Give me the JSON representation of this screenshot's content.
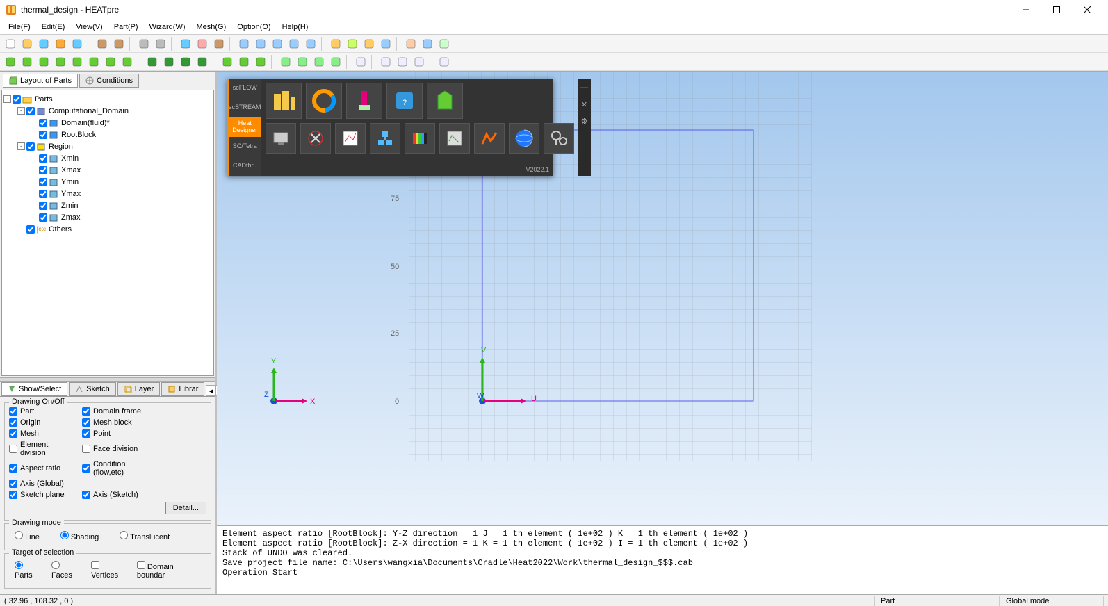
{
  "title": "thermal_design - HEATpre",
  "menu": [
    "File(F)",
    "Edit(E)",
    "View(V)",
    "Part(P)",
    "Wizard(W)",
    "Mesh(G)",
    "Option(O)",
    "Help(H)"
  ],
  "leftTabs": {
    "active": "Layout of Parts",
    "other": "Conditions"
  },
  "tree": {
    "root": "Parts",
    "items": [
      {
        "label": "Computational_Domain",
        "depth": 1,
        "exp": "-",
        "color": "#78c"
      },
      {
        "label": "Domain(fluid)*",
        "depth": 2,
        "exp": "",
        "color": "#39f"
      },
      {
        "label": "RootBlock",
        "depth": 2,
        "exp": "",
        "color": "#39f"
      },
      {
        "label": "Region",
        "depth": 1,
        "exp": "-",
        "color": "#fd0"
      },
      {
        "label": "Xmin",
        "depth": 2,
        "exp": "",
        "color": "#7bd"
      },
      {
        "label": "Xmax",
        "depth": 2,
        "exp": "",
        "color": "#7bd"
      },
      {
        "label": "Ymin",
        "depth": 2,
        "exp": "",
        "color": "#7bd"
      },
      {
        "label": "Ymax",
        "depth": 2,
        "exp": "",
        "color": "#7bd"
      },
      {
        "label": "Zmin",
        "depth": 2,
        "exp": "",
        "color": "#7bd"
      },
      {
        "label": "Zmax",
        "depth": 2,
        "exp": "",
        "color": "#7bd"
      },
      {
        "label": "Others",
        "depth": 1,
        "exp": "",
        "color": "#fd0",
        "tag": "etc"
      }
    ]
  },
  "panelTabs": [
    "Show/Select",
    "Sketch",
    "Layer",
    "Librar"
  ],
  "drawingOnOff": {
    "title": "Drawing On/Off",
    "items": [
      {
        "label": "Part",
        "checked": true
      },
      {
        "label": "Domain frame",
        "checked": true
      },
      {
        "label": "Origin",
        "checked": true
      },
      {
        "label": "Mesh block",
        "checked": true
      },
      {
        "label": "Mesh",
        "checked": true
      },
      {
        "label": "Point",
        "checked": true
      },
      {
        "label": "Element division",
        "checked": false
      },
      {
        "label": "Face division",
        "checked": false
      },
      {
        "label": "Aspect ratio",
        "checked": true
      },
      {
        "label": "Condition (flow,etc)",
        "checked": true
      },
      {
        "label": "Axis (Global)",
        "checked": true
      },
      {
        "label": "",
        "checked": false,
        "empty": true
      },
      {
        "label": "Sketch plane",
        "checked": true
      },
      {
        "label": "Axis (Sketch)",
        "checked": true
      }
    ],
    "detail": "Detail..."
  },
  "drawingMode": {
    "title": "Drawing mode",
    "options": [
      "Line",
      "Shading",
      "Translucent"
    ],
    "selected": "Shading"
  },
  "target": {
    "title": "Target of selection",
    "options": [
      {
        "label": "Parts",
        "type": "radio",
        "checked": true
      },
      {
        "label": "Faces",
        "type": "radio",
        "checked": false
      },
      {
        "label": "Vertices",
        "type": "check",
        "checked": false
      },
      {
        "label": "Domain boundar",
        "type": "check",
        "checked": false
      }
    ]
  },
  "axes": {
    "ticks": [
      "0",
      "25",
      "50",
      "75"
    ],
    "world": {
      "x": "X",
      "y": "Y",
      "z": "Z"
    },
    "sketch": {
      "u": "U",
      "v": "V",
      "w": "W"
    }
  },
  "launcher": {
    "tabs": [
      "scFLOW",
      "scSTREAM",
      "Heat Designer",
      "SC/Tetra",
      "CADthru"
    ],
    "active": "Heat Designer",
    "version": "V2022.1"
  },
  "console": [
    "Element aspect ratio [RootBlock]: Y-Z direction = 1 J = 1 th element ( 1e+02 ) K = 1 th element ( 1e+02 )",
    "Element aspect ratio [RootBlock]: Z-X direction = 1 K = 1 th element ( 1e+02 ) I = 1 th element ( 1e+02 )",
    "Stack of UNDO was cleared.",
    "Save project file name: C:\\Users\\wangxia\\Documents\\Cradle\\Heat2022\\Work\\thermal_design_$$$.cab",
    "Operation Start"
  ],
  "status": {
    "coords": "( 32.96 , 108.32 , 0 )",
    "mode1": "Part",
    "mode2": "Global mode"
  }
}
